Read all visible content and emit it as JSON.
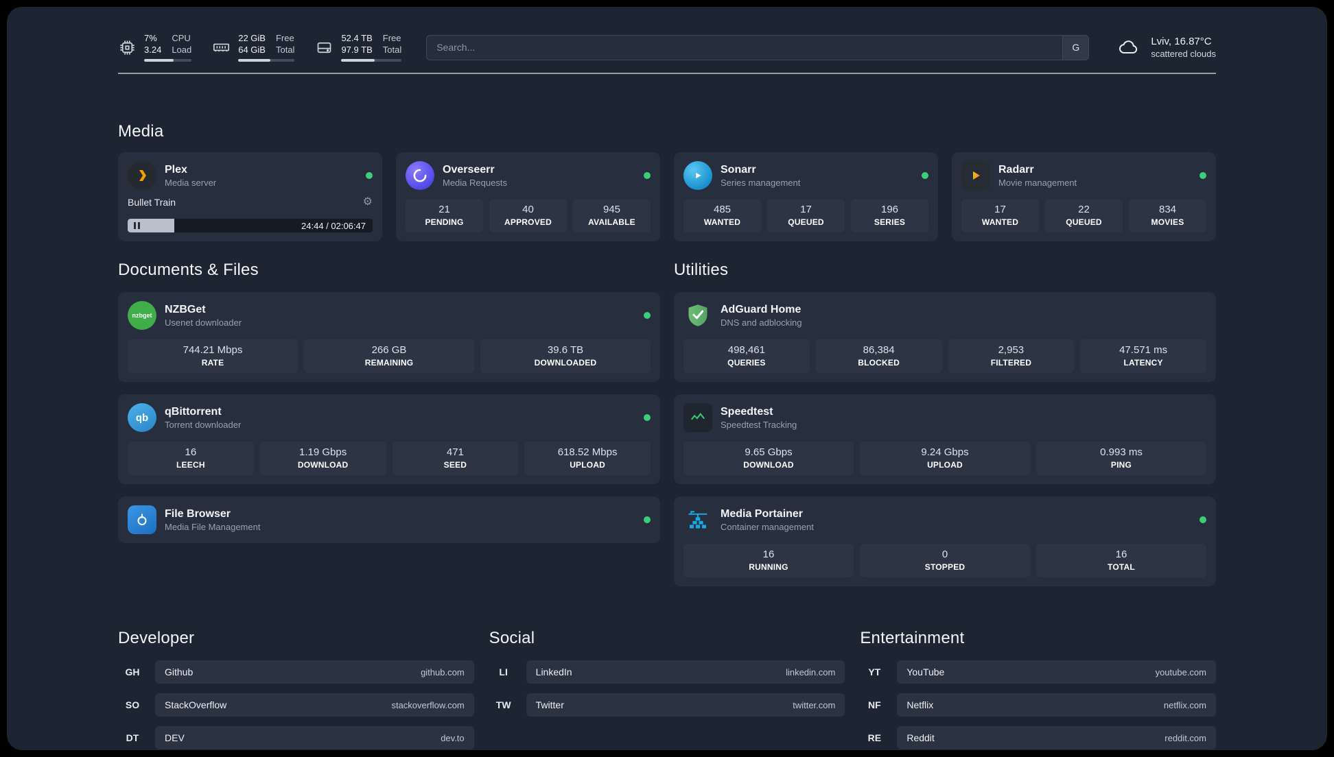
{
  "colors": {
    "status_online": "#3ccf77",
    "accent_green": "#35d07a",
    "portainer_blue": "#1ba8e0"
  },
  "header": {
    "cpu": {
      "value_top": "7%",
      "value_bottom": "3.24",
      "label_top": "CPU",
      "label_bottom": "Load"
    },
    "ram": {
      "value_top": "22 GiB",
      "value_bottom": "64 GiB",
      "label_top": "Free",
      "label_bottom": "Total"
    },
    "disk": {
      "value_top": "52.4 TB",
      "value_bottom": "97.9 TB",
      "label_top": "Free",
      "label_bottom": "Total"
    },
    "search": {
      "placeholder": "Search...",
      "button_label": "G"
    },
    "weather": {
      "location_temp": "Lviv, 16.87°C",
      "condition": "scattered clouds"
    }
  },
  "sections": {
    "media_title": "Media",
    "documents_title": "Documents & Files",
    "utilities_title": "Utilities",
    "developer_title": "Developer",
    "social_title": "Social",
    "entertainment_title": "Entertainment"
  },
  "apps": {
    "plex": {
      "name": "Plex",
      "subtitle": "Media server",
      "now_playing": "Bullet Train",
      "time": "24:44 / 02:06:47",
      "progress_percent": 19
    },
    "overseerr": {
      "name": "Overseerr",
      "subtitle": "Media Requests",
      "stats": [
        {
          "value": "21",
          "label": "PENDING"
        },
        {
          "value": "40",
          "label": "APPROVED"
        },
        {
          "value": "945",
          "label": "AVAILABLE"
        }
      ]
    },
    "sonarr": {
      "name": "Sonarr",
      "subtitle": "Series management",
      "stats": [
        {
          "value": "485",
          "label": "WANTED"
        },
        {
          "value": "17",
          "label": "QUEUED"
        },
        {
          "value": "196",
          "label": "SERIES"
        }
      ]
    },
    "radarr": {
      "name": "Radarr",
      "subtitle": "Movie management",
      "stats": [
        {
          "value": "17",
          "label": "WANTED"
        },
        {
          "value": "22",
          "label": "QUEUED"
        },
        {
          "value": "834",
          "label": "MOVIES"
        }
      ]
    },
    "nzbget": {
      "name": "NZBGet",
      "subtitle": "Usenet downloader",
      "icon_text": "nzbget",
      "stats": [
        {
          "value": "744.21 Mbps",
          "label": "RATE"
        },
        {
          "value": "266 GB",
          "label": "REMAINING"
        },
        {
          "value": "39.6 TB",
          "label": "DOWNLOADED"
        }
      ]
    },
    "qbittorrent": {
      "name": "qBittorrent",
      "subtitle": "Torrent downloader",
      "icon_text": "qb",
      "stats": [
        {
          "value": "16",
          "label": "LEECH"
        },
        {
          "value": "1.19 Gbps",
          "label": "DOWNLOAD"
        },
        {
          "value": "471",
          "label": "SEED"
        },
        {
          "value": "618.52 Mbps",
          "label": "UPLOAD"
        }
      ]
    },
    "filebrowser": {
      "name": "File Browser",
      "subtitle": "Media File Management"
    },
    "adguard": {
      "name": "AdGuard Home",
      "subtitle": "DNS and adblocking",
      "stats": [
        {
          "value": "498,461",
          "label": "QUERIES"
        },
        {
          "value": "86,384",
          "label": "BLOCKED"
        },
        {
          "value": "2,953",
          "label": "FILTERED"
        },
        {
          "value": "47.571 ms",
          "label": "LATENCY"
        }
      ]
    },
    "speedtest": {
      "name": "Speedtest",
      "subtitle": "Speedtest Tracking",
      "stats": [
        {
          "value": "9.65 Gbps",
          "label": "DOWNLOAD"
        },
        {
          "value": "9.24 Gbps",
          "label": "UPLOAD"
        },
        {
          "value": "0.993 ms",
          "label": "PING"
        }
      ]
    },
    "portainer": {
      "name": "Media Portainer",
      "subtitle": "Container management",
      "stats": [
        {
          "value": "16",
          "label": "RUNNING"
        },
        {
          "value": "0",
          "label": "STOPPED"
        },
        {
          "value": "16",
          "label": "TOTAL"
        }
      ]
    }
  },
  "bookmarks": {
    "developer": [
      {
        "abbr": "GH",
        "name": "Github",
        "url": "github.com"
      },
      {
        "abbr": "SO",
        "name": "StackOverflow",
        "url": "stackoverflow.com"
      },
      {
        "abbr": "DT",
        "name": "DEV",
        "url": "dev.to"
      }
    ],
    "social": [
      {
        "abbr": "LI",
        "name": "LinkedIn",
        "url": "linkedin.com"
      },
      {
        "abbr": "TW",
        "name": "Twitter",
        "url": "twitter.com"
      }
    ],
    "entertainment": [
      {
        "abbr": "YT",
        "name": "YouTube",
        "url": "youtube.com"
      },
      {
        "abbr": "NF",
        "name": "Netflix",
        "url": "netflix.com"
      },
      {
        "abbr": "RE",
        "name": "Reddit",
        "url": "reddit.com"
      }
    ]
  }
}
